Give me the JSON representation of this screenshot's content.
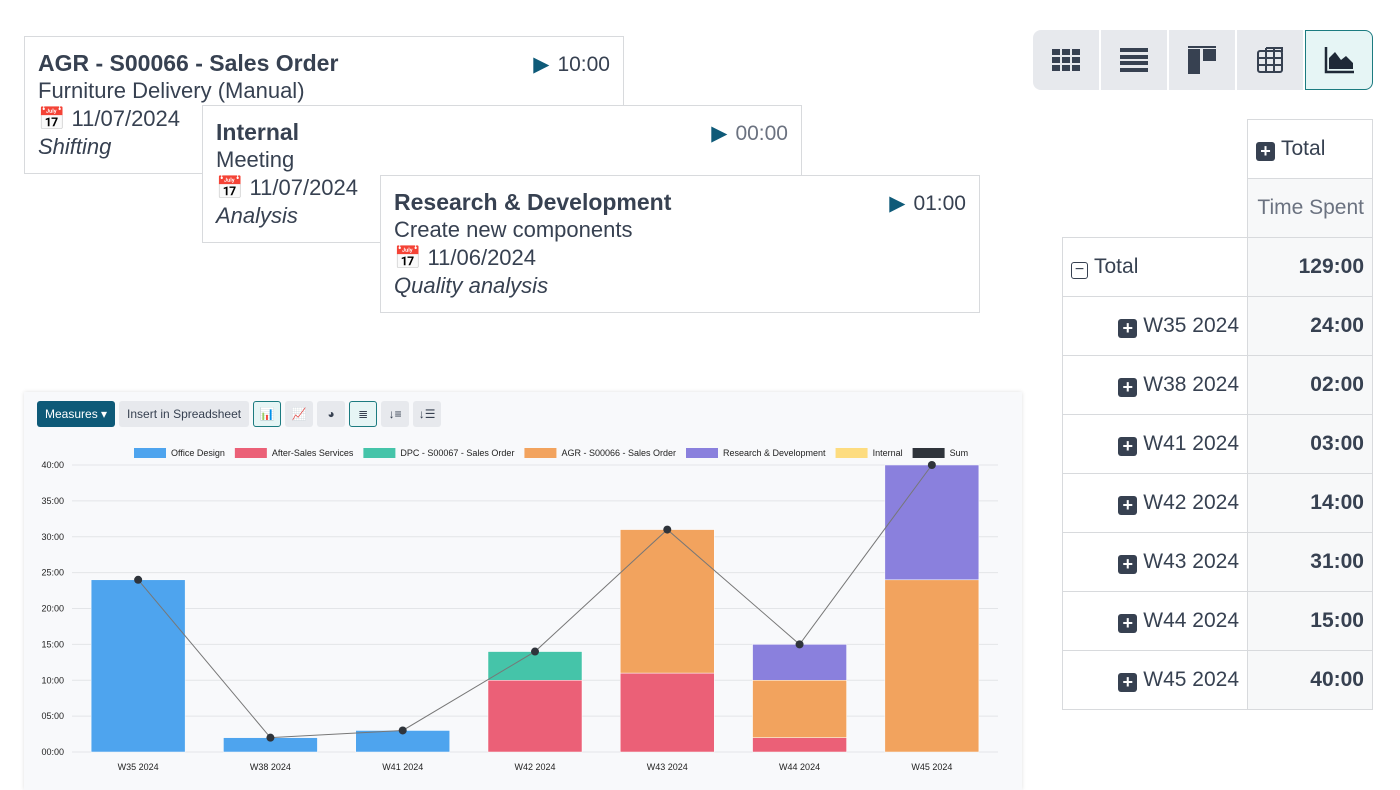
{
  "cards": [
    {
      "title": "AGR - S00066 - Sales Order",
      "time": "10:00",
      "subtitle": "Furniture Delivery (Manual)",
      "date": "11/07/2024",
      "task": "Shifting"
    },
    {
      "title": "Internal",
      "time": "00:00",
      "subtitle": "Meeting",
      "date": "11/07/2024",
      "task": "Analysis"
    },
    {
      "title": "Research & Development",
      "time": "01:00",
      "subtitle": "Create new components",
      "date": "11/06/2024",
      "task": "Quality analysis"
    }
  ],
  "views": [
    "kanban",
    "list",
    "gantt",
    "pivot",
    "graph"
  ],
  "pivot": {
    "col_header": "Total",
    "measure": "Time Spent",
    "total_label": "Total",
    "total_value": "129:00",
    "rows": [
      {
        "label": "W35 2024",
        "value": "24:00"
      },
      {
        "label": "W38 2024",
        "value": "02:00"
      },
      {
        "label": "W41 2024",
        "value": "03:00"
      },
      {
        "label": "W42 2024",
        "value": "14:00"
      },
      {
        "label": "W43 2024",
        "value": "31:00"
      },
      {
        "label": "W44 2024",
        "value": "15:00"
      },
      {
        "label": "W45 2024",
        "value": "40:00"
      }
    ]
  },
  "toolbar": {
    "measures": "Measures",
    "insert": "Insert in Spreadsheet"
  },
  "chart_data": {
    "type": "bar",
    "stacked": true,
    "categories": [
      "W35 2024",
      "W38 2024",
      "W41 2024",
      "W42 2024",
      "W43 2024",
      "W44 2024",
      "W45 2024"
    ],
    "yticks": [
      "00:00",
      "05:00",
      "10:00",
      "15:00",
      "20:00",
      "25:00",
      "30:00",
      "35:00",
      "40:00"
    ],
    "ylim": [
      0,
      40
    ],
    "legend": "top",
    "series": [
      {
        "name": "Office Design",
        "color": "#4ea4ee",
        "values": [
          24,
          2,
          3,
          0,
          0,
          0,
          0
        ]
      },
      {
        "name": "After-Sales Services",
        "color": "#eb6077",
        "values": [
          0,
          0,
          0,
          10,
          11,
          2,
          0
        ]
      },
      {
        "name": "DPC - S00067 - Sales Order",
        "color": "#45c4a9",
        "values": [
          0,
          0,
          0,
          4,
          0,
          0,
          0
        ]
      },
      {
        "name": "AGR - S00066 - Sales Order",
        "color": "#f2a35e",
        "values": [
          0,
          0,
          0,
          0,
          20,
          8,
          24
        ]
      },
      {
        "name": "Research & Development",
        "color": "#8a80dd",
        "values": [
          0,
          0,
          0,
          0,
          0,
          5,
          16
        ]
      },
      {
        "name": "Internal",
        "color": "#fddc7f",
        "values": [
          0,
          0,
          0,
          0,
          0,
          0,
          0
        ]
      },
      {
        "name": "Sum",
        "color": "#2f343b",
        "type": "line",
        "values": [
          24,
          2,
          3,
          14,
          31,
          15,
          40
        ]
      }
    ]
  }
}
